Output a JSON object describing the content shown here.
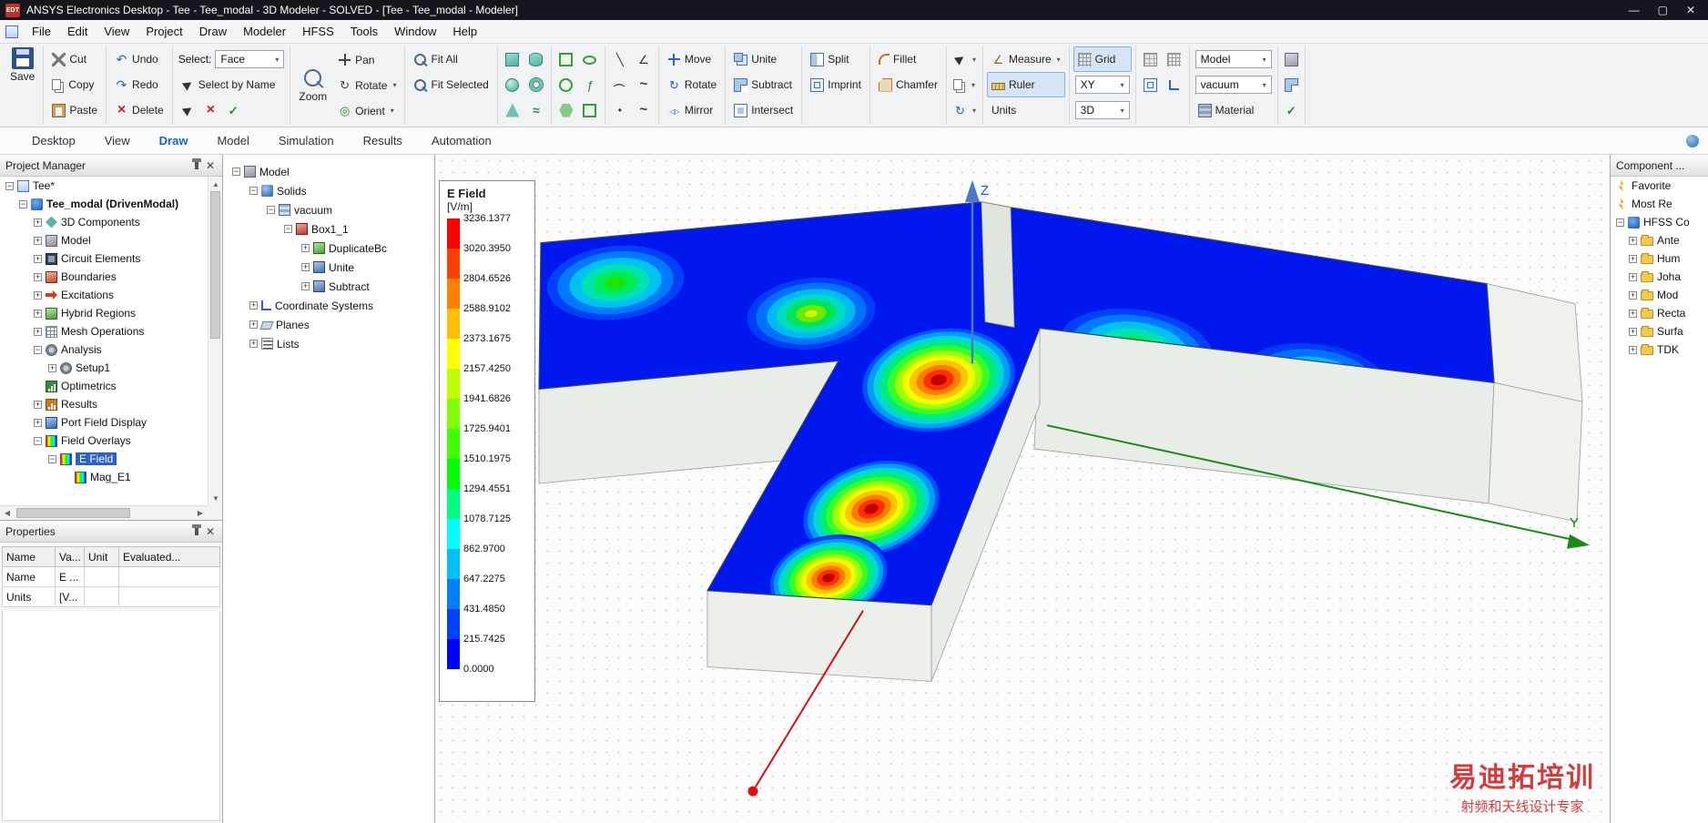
{
  "window": {
    "icon_text": "EDT",
    "title": "ANSYS Electronics Desktop - Tee - Tee_modal - 3D Modeler - SOLVED - [Tee - Tee_modal - Modeler]"
  },
  "menu": {
    "items": [
      "File",
      "Edit",
      "View",
      "Project",
      "Draw",
      "Modeler",
      "HFSS",
      "Tools",
      "Window",
      "Help"
    ]
  },
  "toolbar": {
    "save": "Save",
    "cut": "Cut",
    "copy": "Copy",
    "paste": "Paste",
    "undo": "Undo",
    "redo": "Redo",
    "delete": "Delete",
    "select_label": "Select:",
    "select_mode": "Face",
    "select_by_name": "Select by Name",
    "zoom": "Zoom",
    "pan": "Pan",
    "rotate_view": "Rotate",
    "orient": "Orient",
    "fit_all": "Fit All",
    "fit_selected": "Fit Selected",
    "move": "Move",
    "rotate_op": "Rotate",
    "mirror": "Mirror",
    "unite": "Unite",
    "subtract": "Subtract",
    "intersect": "Intersect",
    "split": "Split",
    "imprint": "Imprint",
    "fillet": "Fillet",
    "chamfer": "Chamfer",
    "measure": "Measure",
    "ruler": "Ruler",
    "units": "Units",
    "grid": "Grid",
    "grid_plane": "XY",
    "grid_mode": "3D",
    "model": "Model",
    "material_value": "vacuum",
    "material_label": "Material"
  },
  "ribbon": {
    "tabs": [
      "Desktop",
      "View",
      "Draw",
      "Model",
      "Simulation",
      "Results",
      "Automation"
    ]
  },
  "project_manager": {
    "title": "Project Manager",
    "tree": [
      "Tee*",
      "Tee_modal (DrivenModal)",
      "3D Components",
      "Model",
      "Circuit Elements",
      "Boundaries",
      "Excitations",
      "Hybrid Regions",
      "Mesh Operations",
      "Analysis",
      "Setup1",
      "Optimetrics",
      "Results",
      "Port Field Display",
      "Field Overlays",
      "E Field",
      "Mag_E1"
    ]
  },
  "properties": {
    "title": "Properties",
    "columns": [
      "Name",
      "Va...",
      "Unit",
      "Evaluated..."
    ],
    "rows": [
      [
        "Name",
        "E ...",
        "",
        ""
      ],
      [
        "Units",
        "[V...",
        "",
        ""
      ]
    ]
  },
  "model_tree": [
    "Model",
    "Solids",
    "vacuum",
    "Box1_1",
    "DuplicateBc",
    "Unite",
    "Subtract",
    "Coordinate Systems",
    "Planes",
    "Lists"
  ],
  "legend": {
    "title": "E Field",
    "unit": "[V/m]",
    "values": [
      "3236.1377",
      "3020.3950",
      "2804.6526",
      "2588.9102",
      "2373.1675",
      "2157.4250",
      "1941.6826",
      "1725.9401",
      "1510.1975",
      "1294.4551",
      "1078.7125",
      "862.9700",
      "647.2275",
      "431.4850",
      "215.7425",
      "0.0000"
    ],
    "colors": [
      "#ff0000",
      "#ff4000",
      "#ff8000",
      "#ffbf00",
      "#ffff00",
      "#bfff00",
      "#80ff00",
      "#40ff00",
      "#00ff00",
      "#00ff80",
      "#00ffff",
      "#00bfff",
      "#0080ff",
      "#0040ff",
      "#0000ff"
    ]
  },
  "axes": {
    "y": "Y",
    "z": "Z"
  },
  "component_panel": {
    "title": "Component ...",
    "items": [
      "Favorite",
      "Most Re",
      "HFSS Co",
      "Ante",
      "Hum",
      "Joha",
      "Mod",
      "Recta",
      "Surfa",
      "TDK"
    ]
  },
  "watermark": {
    "line1": "易迪拓培训",
    "line2": "射频和天线设计专家"
  }
}
